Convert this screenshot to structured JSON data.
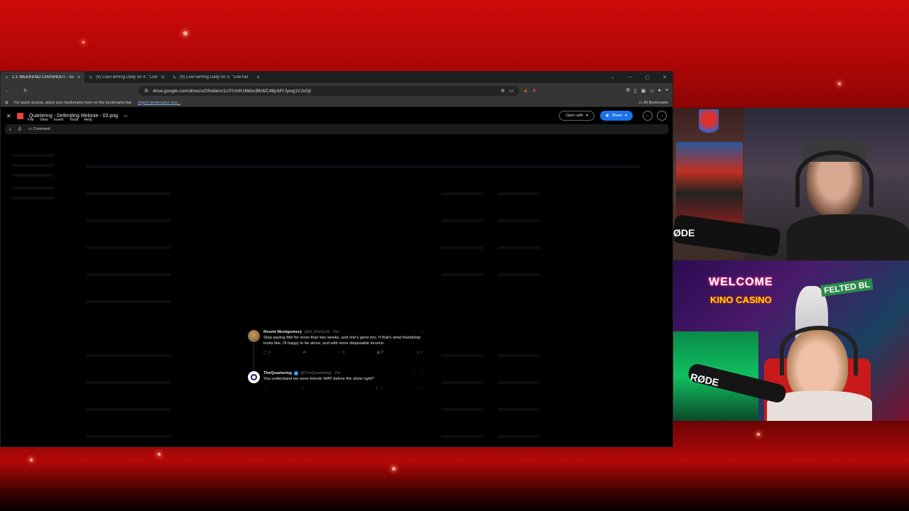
{
  "browser": {
    "tabs": [
      {
        "label": "1.1 WEEKEND CRASHOUT - Goo",
        "icon": "google-drive-icon",
        "active": true
      },
      {
        "label": "(9) LowTierRog Daily on X: \"LowTierG",
        "icon": "x-logo-icon",
        "active": false
      },
      {
        "label": "(9) LowTierRog Daily on X: \"LowTierG",
        "icon": "x-logo-icon",
        "active": false
      }
    ],
    "new_tab": "+",
    "url": "drive.google.com/drive/u/2/folders/1z3YmrKzMdncBkWC46jcMYJywg1VJxGjl",
    "bookmarks_hint": "For quick access, place your bookmarks here on the bookmarks bar.",
    "import_link": "Import bookmarks now...",
    "all_bookmarks": "All Bookmarks"
  },
  "drive": {
    "file_name": "Quartering - Defending Melonie - 03.png",
    "menus": [
      "File",
      "View",
      "Insert",
      "Tools",
      "Help"
    ],
    "open_with": "Open with",
    "share": "Share",
    "comment": "Comment"
  },
  "tweets": [
    {
      "name": "Reemt Montgomery",
      "handle": "@M_Monty26 · 4m",
      "text": "Stop paying Mel for more than two weeks, and she's gone bro. If that's what friendship looks like, I'll happy to be alone, and with more disposable income.",
      "replies": "1",
      "retweets": "",
      "likes": "3",
      "views": "27"
    },
    {
      "name": "TheQuartering",
      "handle": "@TheQuartering · 2m",
      "text": "You understand we were friends WAY before the show right?",
      "replies": "",
      "retweets": "",
      "likes": "",
      "views": "23"
    }
  ],
  "overlay": {
    "sign_welcome": "WELCOME",
    "sign_casino": "KINO CASINO",
    "street_sign": "FELTED BL",
    "mic_brand_1": "ØDE",
    "mic_brand_2": "RØDE"
  },
  "colors": {
    "background_red": "#d10a0a",
    "share_blue": "#1a73e8",
    "verified_blue": "#1d9bf0"
  }
}
